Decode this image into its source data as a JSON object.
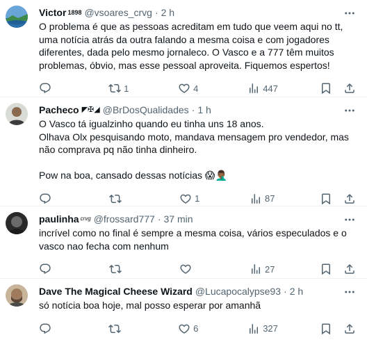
{
  "tweets": [
    {
      "name": "Victor",
      "badge": "1898",
      "handle": "@vsoares_crvg",
      "sep": "·",
      "time": "2 h",
      "text": "O problema é que as pessoas acreditam em tudo que veem aqui no tt, uma notícia atrás da outra falando a mesma coisa e com jogadores diferentes, dada pelo mesmo jornaleco. O Vasco e a 777 têm muitos problemas, óbvio, mas esse pessoal aproveita. Fiquemos espertos!",
      "replies": "",
      "retweets": "1",
      "likes": "4",
      "views": "447"
    },
    {
      "name": "Pacheco",
      "badge": "◤✠◢",
      "handle": "@BrDosQualidades",
      "sep": "·",
      "time": "1 h",
      "text": "O Vasco tá igualzinho quando eu tinha uns 18 anos.\nOlhava Olx pesquisando moto, mandava mensagem pro vendedor, mas não comprava pq não tinha dinheiro.\n\nPow na boa, cansado dessas notícias 😱🤦🏾‍♂️",
      "replies": "",
      "retweets": "",
      "likes": "1",
      "views": "87"
    },
    {
      "name": "paulinha",
      "badge": "crvg",
      "handle": "@frossard777",
      "sep": "·",
      "time": "37 min",
      "text": "incrível como no final é sempre a mesma coisa, vários especulados e o vasco nao fecha com nenhum",
      "replies": "",
      "retweets": "",
      "likes": "",
      "views": "27"
    },
    {
      "name": "Dave The Magical Cheese Wizard",
      "badge": "",
      "handle": "@Lucapocalypse93",
      "sep": "·",
      "time": "2 h",
      "text": "só notícia boa hoje, mal posso esperar por amanhã",
      "replies": "",
      "retweets": "",
      "likes": "6",
      "views": "327"
    }
  ],
  "icons": {
    "reply": "reply-icon",
    "retweet": "retweet-icon",
    "like": "heart-icon",
    "views": "views-icon",
    "bookmark": "bookmark-icon",
    "share": "share-icon",
    "more": "more-icon"
  },
  "colors": {
    "text": "#0f1419",
    "secondary": "#536471",
    "border": "#eff3f4"
  }
}
